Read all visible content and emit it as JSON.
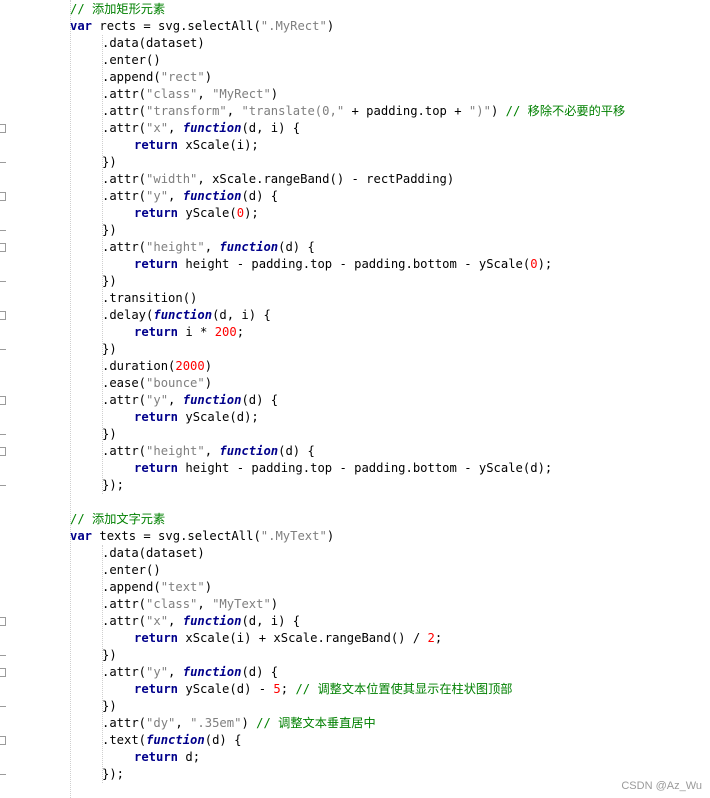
{
  "editor": {
    "lines": [
      {
        "indent": 0,
        "tokens": [
          {
            "t": "com",
            "v": "// 添加矩形元素"
          }
        ]
      },
      {
        "indent": 0,
        "tokens": [
          {
            "t": "kw",
            "v": "var"
          },
          {
            "t": "pl",
            "v": " rects = svg.selectAll("
          },
          {
            "t": "str",
            "v": "\".MyRect\""
          },
          {
            "t": "pl",
            "v": ")"
          }
        ]
      },
      {
        "indent": 1,
        "tokens": [
          {
            "t": "pl",
            "v": ".data(dataset)"
          }
        ]
      },
      {
        "indent": 1,
        "tokens": [
          {
            "t": "pl",
            "v": ".enter()"
          }
        ]
      },
      {
        "indent": 1,
        "tokens": [
          {
            "t": "pl",
            "v": ".append("
          },
          {
            "t": "str",
            "v": "\"rect\""
          },
          {
            "t": "pl",
            "v": ")"
          }
        ]
      },
      {
        "indent": 1,
        "tokens": [
          {
            "t": "pl",
            "v": ".attr("
          },
          {
            "t": "str",
            "v": "\"class\""
          },
          {
            "t": "pl",
            "v": ", "
          },
          {
            "t": "str",
            "v": "\"MyRect\""
          },
          {
            "t": "pl",
            "v": ")"
          }
        ]
      },
      {
        "indent": 1,
        "tokens": [
          {
            "t": "pl",
            "v": ".attr("
          },
          {
            "t": "str",
            "v": "\"transform\""
          },
          {
            "t": "pl",
            "v": ", "
          },
          {
            "t": "str",
            "v": "\"translate(0,\""
          },
          {
            "t": "pl",
            "v": " + padding.top + "
          },
          {
            "t": "str",
            "v": "\")\""
          },
          {
            "t": "pl",
            "v": ") "
          },
          {
            "t": "com",
            "v": "// 移除不必要的平移"
          }
        ]
      },
      {
        "indent": 1,
        "fold": true,
        "tokens": [
          {
            "t": "pl",
            "v": ".attr("
          },
          {
            "t": "str",
            "v": "\"x\""
          },
          {
            "t": "pl",
            "v": ", "
          },
          {
            "t": "fn",
            "v": "function"
          },
          {
            "t": "pl",
            "v": "(d, i) {"
          }
        ]
      },
      {
        "indent": 2,
        "tokens": [
          {
            "t": "kw",
            "v": "return"
          },
          {
            "t": "pl",
            "v": " xScale(i);"
          }
        ]
      },
      {
        "indent": 1,
        "end": true,
        "tokens": [
          {
            "t": "pl",
            "v": "})"
          }
        ]
      },
      {
        "indent": 1,
        "tokens": [
          {
            "t": "pl",
            "v": ".attr("
          },
          {
            "t": "str",
            "v": "\"width\""
          },
          {
            "t": "pl",
            "v": ", xScale.rangeBand() - rectPadding)"
          }
        ]
      },
      {
        "indent": 1,
        "fold": true,
        "tokens": [
          {
            "t": "pl",
            "v": ".attr("
          },
          {
            "t": "str",
            "v": "\"y\""
          },
          {
            "t": "pl",
            "v": ", "
          },
          {
            "t": "fn",
            "v": "function"
          },
          {
            "t": "pl",
            "v": "(d) {"
          }
        ]
      },
      {
        "indent": 2,
        "tokens": [
          {
            "t": "kw",
            "v": "return"
          },
          {
            "t": "pl",
            "v": " yScale("
          },
          {
            "t": "num",
            "v": "0"
          },
          {
            "t": "pl",
            "v": ");"
          }
        ]
      },
      {
        "indent": 1,
        "end": true,
        "tokens": [
          {
            "t": "pl",
            "v": "})"
          }
        ]
      },
      {
        "indent": 1,
        "fold": true,
        "tokens": [
          {
            "t": "pl",
            "v": ".attr("
          },
          {
            "t": "str",
            "v": "\"height\""
          },
          {
            "t": "pl",
            "v": ", "
          },
          {
            "t": "fn",
            "v": "function"
          },
          {
            "t": "pl",
            "v": "(d) {"
          }
        ]
      },
      {
        "indent": 2,
        "tokens": [
          {
            "t": "kw",
            "v": "return"
          },
          {
            "t": "pl",
            "v": " height - padding.top - padding.bottom - yScale("
          },
          {
            "t": "num",
            "v": "0"
          },
          {
            "t": "pl",
            "v": ");"
          }
        ]
      },
      {
        "indent": 1,
        "end": true,
        "tokens": [
          {
            "t": "pl",
            "v": "})"
          }
        ]
      },
      {
        "indent": 1,
        "tokens": [
          {
            "t": "pl",
            "v": ".transition()"
          }
        ]
      },
      {
        "indent": 1,
        "fold": true,
        "tokens": [
          {
            "t": "pl",
            "v": ".delay("
          },
          {
            "t": "fn",
            "v": "function"
          },
          {
            "t": "pl",
            "v": "(d, i) {"
          }
        ]
      },
      {
        "indent": 2,
        "tokens": [
          {
            "t": "kw",
            "v": "return"
          },
          {
            "t": "pl",
            "v": " i * "
          },
          {
            "t": "num",
            "v": "200"
          },
          {
            "t": "pl",
            "v": ";"
          }
        ]
      },
      {
        "indent": 1,
        "end": true,
        "tokens": [
          {
            "t": "pl",
            "v": "})"
          }
        ]
      },
      {
        "indent": 1,
        "tokens": [
          {
            "t": "pl",
            "v": ".duration("
          },
          {
            "t": "num",
            "v": "2000"
          },
          {
            "t": "pl",
            "v": ")"
          }
        ]
      },
      {
        "indent": 1,
        "tokens": [
          {
            "t": "pl",
            "v": ".ease("
          },
          {
            "t": "str",
            "v": "\"bounce\""
          },
          {
            "t": "pl",
            "v": ")"
          }
        ]
      },
      {
        "indent": 1,
        "fold": true,
        "tokens": [
          {
            "t": "pl",
            "v": ".attr("
          },
          {
            "t": "str",
            "v": "\"y\""
          },
          {
            "t": "pl",
            "v": ", "
          },
          {
            "t": "fn",
            "v": "function"
          },
          {
            "t": "pl",
            "v": "(d) {"
          }
        ]
      },
      {
        "indent": 2,
        "tokens": [
          {
            "t": "kw",
            "v": "return"
          },
          {
            "t": "pl",
            "v": " yScale(d);"
          }
        ]
      },
      {
        "indent": 1,
        "end": true,
        "tokens": [
          {
            "t": "pl",
            "v": "})"
          }
        ]
      },
      {
        "indent": 1,
        "fold": true,
        "tokens": [
          {
            "t": "pl",
            "v": ".attr("
          },
          {
            "t": "str",
            "v": "\"height\""
          },
          {
            "t": "pl",
            "v": ", "
          },
          {
            "t": "fn",
            "v": "function"
          },
          {
            "t": "pl",
            "v": "(d) {"
          }
        ]
      },
      {
        "indent": 2,
        "tokens": [
          {
            "t": "kw",
            "v": "return"
          },
          {
            "t": "pl",
            "v": " height - padding.top - padding.bottom - yScale(d);"
          }
        ]
      },
      {
        "indent": 1,
        "end": true,
        "tokens": [
          {
            "t": "pl",
            "v": "});"
          }
        ]
      },
      {
        "indent": 0,
        "tokens": []
      },
      {
        "indent": 0,
        "tokens": [
          {
            "t": "com",
            "v": "// 添加文字元素"
          }
        ]
      },
      {
        "indent": 0,
        "tokens": [
          {
            "t": "kw",
            "v": "var"
          },
          {
            "t": "pl",
            "v": " texts = svg.selectAll("
          },
          {
            "t": "str",
            "v": "\".MyText\""
          },
          {
            "t": "pl",
            "v": ")"
          }
        ]
      },
      {
        "indent": 1,
        "tokens": [
          {
            "t": "pl",
            "v": ".data(dataset)"
          }
        ]
      },
      {
        "indent": 1,
        "tokens": [
          {
            "t": "pl",
            "v": ".enter()"
          }
        ]
      },
      {
        "indent": 1,
        "tokens": [
          {
            "t": "pl",
            "v": ".append("
          },
          {
            "t": "str",
            "v": "\"text\""
          },
          {
            "t": "pl",
            "v": ")"
          }
        ]
      },
      {
        "indent": 1,
        "tokens": [
          {
            "t": "pl",
            "v": ".attr("
          },
          {
            "t": "str",
            "v": "\"class\""
          },
          {
            "t": "pl",
            "v": ", "
          },
          {
            "t": "str",
            "v": "\"MyText\""
          },
          {
            "t": "pl",
            "v": ")"
          }
        ]
      },
      {
        "indent": 1,
        "fold": true,
        "tokens": [
          {
            "t": "pl",
            "v": ".attr("
          },
          {
            "t": "str",
            "v": "\"x\""
          },
          {
            "t": "pl",
            "v": ", "
          },
          {
            "t": "fn",
            "v": "function"
          },
          {
            "t": "pl",
            "v": "(d, i) {"
          }
        ]
      },
      {
        "indent": 2,
        "tokens": [
          {
            "t": "kw",
            "v": "return"
          },
          {
            "t": "pl",
            "v": " xScale(i) + xScale.rangeBand() / "
          },
          {
            "t": "num",
            "v": "2"
          },
          {
            "t": "pl",
            "v": ";"
          }
        ]
      },
      {
        "indent": 1,
        "end": true,
        "tokens": [
          {
            "t": "pl",
            "v": "})"
          }
        ]
      },
      {
        "indent": 1,
        "fold": true,
        "tokens": [
          {
            "t": "pl",
            "v": ".attr("
          },
          {
            "t": "str",
            "v": "\"y\""
          },
          {
            "t": "pl",
            "v": ", "
          },
          {
            "t": "fn",
            "v": "function"
          },
          {
            "t": "pl",
            "v": "(d) {"
          }
        ]
      },
      {
        "indent": 2,
        "tokens": [
          {
            "t": "kw",
            "v": "return"
          },
          {
            "t": "pl",
            "v": " yScale(d) - "
          },
          {
            "t": "num",
            "v": "5"
          },
          {
            "t": "pl",
            "v": "; "
          },
          {
            "t": "com",
            "v": "// 调整文本位置使其显示在柱状图顶部"
          }
        ]
      },
      {
        "indent": 1,
        "end": true,
        "tokens": [
          {
            "t": "pl",
            "v": "})"
          }
        ]
      },
      {
        "indent": 1,
        "tokens": [
          {
            "t": "pl",
            "v": ".attr("
          },
          {
            "t": "str",
            "v": "\"dy\""
          },
          {
            "t": "pl",
            "v": ", "
          },
          {
            "t": "str",
            "v": "\".35em\""
          },
          {
            "t": "pl",
            "v": ") "
          },
          {
            "t": "com",
            "v": "// 调整文本垂直居中"
          }
        ]
      },
      {
        "indent": 1,
        "fold": true,
        "tokens": [
          {
            "t": "pl",
            "v": ".text("
          },
          {
            "t": "fn",
            "v": "function"
          },
          {
            "t": "pl",
            "v": "(d) {"
          }
        ]
      },
      {
        "indent": 2,
        "tokens": [
          {
            "t": "kw",
            "v": "return"
          },
          {
            "t": "pl",
            "v": " d;"
          }
        ]
      },
      {
        "indent": 1,
        "end": true,
        "tokens": [
          {
            "t": "pl",
            "v": "});"
          }
        ]
      }
    ]
  },
  "watermark": "CSDN @Az_Wu",
  "colors": {
    "keyword": "#00008b",
    "string": "#7f7f7f",
    "number": "#ff0000",
    "comment": "#008000",
    "background": "#ffffff"
  }
}
